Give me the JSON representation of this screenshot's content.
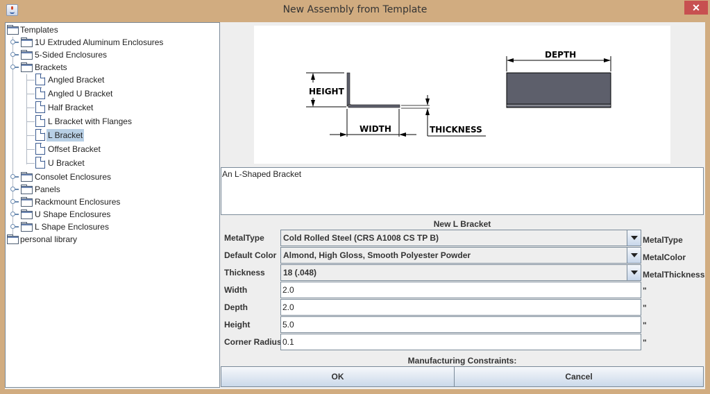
{
  "window": {
    "title": "New Assembly from Template",
    "close_label": "✕"
  },
  "tree": {
    "root": "Templates",
    "groups": [
      {
        "label": "1U Extruded Aluminum Enclosures",
        "expanded": false
      },
      {
        "label": "5-Sided Enclosures",
        "expanded": false
      },
      {
        "label": "Brackets",
        "expanded": true,
        "children": [
          {
            "label": "Angled Bracket"
          },
          {
            "label": "Angled U Bracket"
          },
          {
            "label": "Half Bracket"
          },
          {
            "label": "L Bracket with Flanges"
          },
          {
            "label": "L Bracket",
            "selected": true
          },
          {
            "label": "Offset Bracket"
          },
          {
            "label": "U Bracket"
          }
        ]
      },
      {
        "label": "Consolet Enclosures",
        "expanded": false
      },
      {
        "label": "Panels",
        "expanded": false
      },
      {
        "label": "Rackmount Enclosures",
        "expanded": false
      },
      {
        "label": "U Shape Enclosures",
        "expanded": false
      },
      {
        "label": "L Shape Enclosures",
        "expanded": false
      }
    ],
    "second_root": "personal library"
  },
  "preview": {
    "labels": {
      "height": "HEIGHT",
      "width": "WIDTH",
      "thickness": "THICKNESS",
      "depth": "DEPTH"
    },
    "colors": {
      "metal": "#5d5f6b",
      "line": "#000000"
    }
  },
  "description": "An L-Shaped Bracket",
  "form": {
    "title": "New L Bracket",
    "combos": [
      {
        "label": "MetalType",
        "value": "Cold Rolled Steel (CRS A1008 CS TP B)",
        "suffix": "MetalType"
      },
      {
        "label": "Default Color",
        "value": "Almond, High Gloss, Smooth Polyester Powder",
        "suffix": "MetalColor"
      },
      {
        "label": "Thickness",
        "value": "18 (.048)",
        "suffix": "MetalThickness"
      }
    ],
    "fields": [
      {
        "label": "Width",
        "value": "2.0",
        "unit": "\""
      },
      {
        "label": "Depth",
        "value": "2.0",
        "unit": "\""
      },
      {
        "label": "Height",
        "value": "5.0",
        "unit": "\""
      },
      {
        "label": "Corner Radius",
        "value": "0.1",
        "unit": "\""
      }
    ],
    "constraints_label": "Manufacturing Constraints:"
  },
  "buttons": {
    "ok": "OK",
    "cancel": "Cancel"
  }
}
